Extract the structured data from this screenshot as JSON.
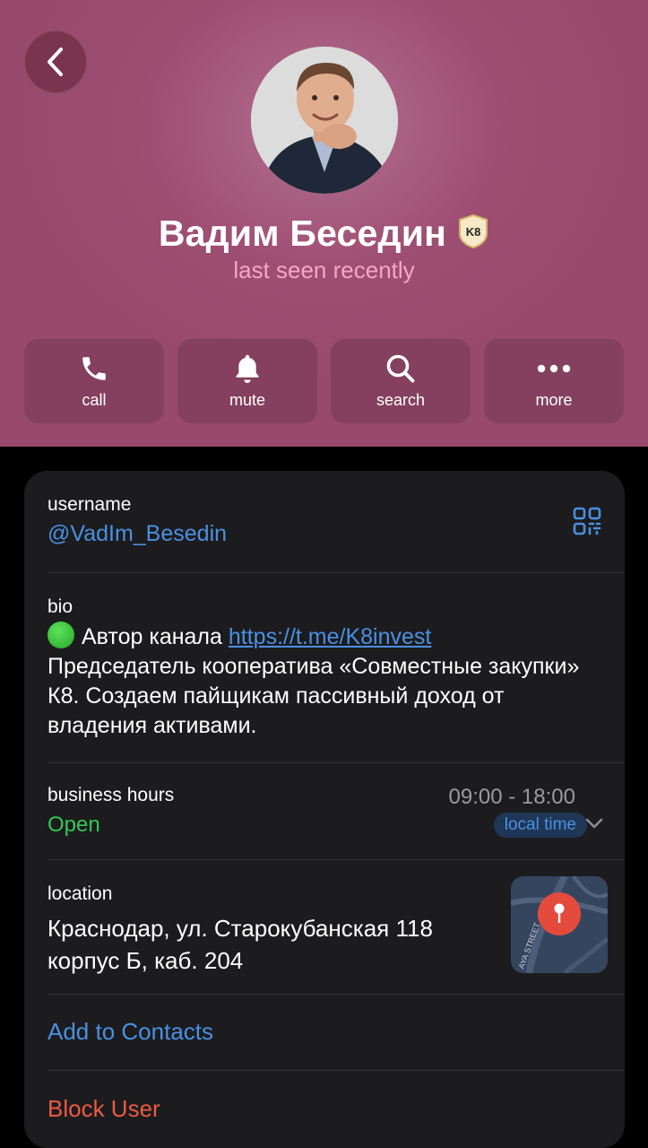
{
  "profile": {
    "name": "Вадим Беседин",
    "status": "last seen recently",
    "badge": "K8"
  },
  "actions": [
    {
      "label": "call",
      "icon": "phone-icon"
    },
    {
      "label": "mute",
      "icon": "bell-icon"
    },
    {
      "label": "search",
      "icon": "search-icon"
    },
    {
      "label": "more",
      "icon": "more-dots-icon"
    }
  ],
  "info": {
    "username_label": "username",
    "username_value": "@VadIm_Besedin",
    "bio_label": "bio",
    "bio_prefix": "Автор канала ",
    "bio_link": "https://t.me/K8invest",
    "bio_line2": "Председатель кооператива «Совместные закупки» К8. Создаем пайщикам пассивный доход от владения активами.",
    "hours_label": "business hours",
    "hours_status": "Open",
    "hours_value": "09:00 - 18:00",
    "hours_pill": "local time",
    "location_label": "location",
    "location_value": "Краснодар, ул. Старокубанская 118 корпус Б, каб. 204",
    "map_street_text": "AYA STREET",
    "add_contacts": "Add to Contacts",
    "block_user": "Block User"
  },
  "colors": {
    "header": "#9d4e72",
    "button": "#84405e",
    "link": "#4a90e2",
    "open": "#34c759",
    "danger": "#eb5a46",
    "card": "#1c1c1e"
  }
}
